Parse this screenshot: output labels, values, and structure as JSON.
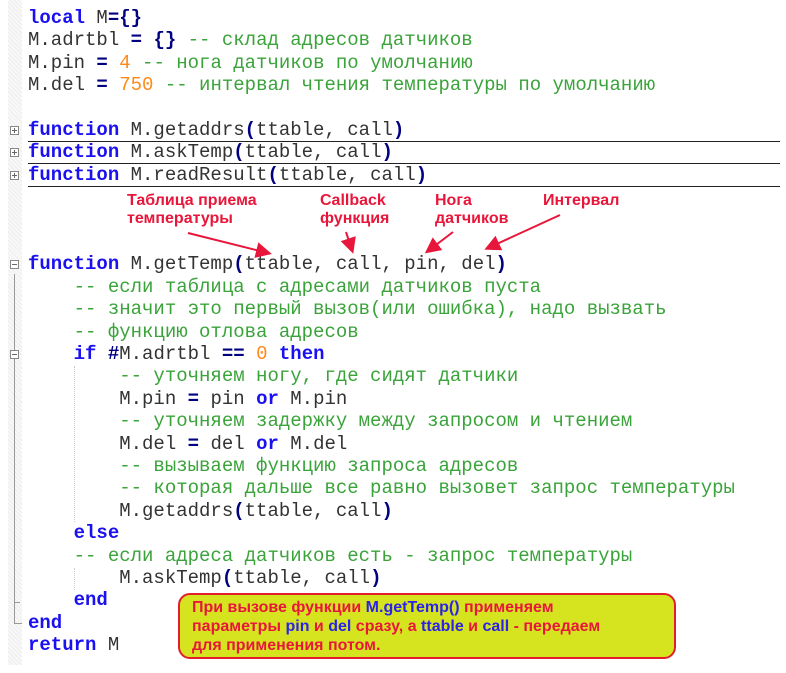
{
  "colors": {
    "keyword": "#1a10f0",
    "operator": "#000080",
    "number": "#ff8a1a",
    "comment": "#3aa33a",
    "annotation": "#e8163a",
    "callout_bg": "#d6e420"
  },
  "code": [
    {
      "row": 0,
      "tokens": [
        [
          "kw",
          "local"
        ],
        [
          "id",
          " M"
        ],
        [
          "op",
          "={}"
        ]
      ]
    },
    {
      "row": 1,
      "tokens": [
        [
          "id",
          "M.adrtbl "
        ],
        [
          "op",
          "="
        ],
        [
          "id",
          " "
        ],
        [
          "op",
          "{}"
        ],
        [
          "cmt",
          " -- склад адресов датчиков"
        ]
      ]
    },
    {
      "row": 2,
      "tokens": [
        [
          "id",
          "M.pin "
        ],
        [
          "op",
          "="
        ],
        [
          "id",
          " "
        ],
        [
          "num",
          "4"
        ],
        [
          "cmt",
          " -- нога датчиков по умолчанию"
        ]
      ]
    },
    {
      "row": 3,
      "tokens": [
        [
          "id",
          "M.del "
        ],
        [
          "op",
          "="
        ],
        [
          "id",
          " "
        ],
        [
          "num",
          "750"
        ],
        [
          "cmt",
          " -- интервал чтения температуры по умолчанию"
        ]
      ]
    },
    {
      "row": 5,
      "fold": "plus",
      "folded": true,
      "tokens": [
        [
          "kw",
          "function"
        ],
        [
          "id",
          " M.getaddrs"
        ],
        [
          "op",
          "("
        ],
        [
          "id",
          "ttable, call"
        ],
        [
          "op",
          ")"
        ]
      ]
    },
    {
      "row": 6,
      "fold": "plus",
      "folded": true,
      "tokens": [
        [
          "kw",
          "function"
        ],
        [
          "id",
          " M.askTemp"
        ],
        [
          "op",
          "("
        ],
        [
          "id",
          "ttable, call"
        ],
        [
          "op",
          ")"
        ]
      ]
    },
    {
      "row": 7,
      "fold": "plus",
      "folded": true,
      "tokens": [
        [
          "kw",
          "function"
        ],
        [
          "id",
          " M.readResult"
        ],
        [
          "op",
          "("
        ],
        [
          "id",
          "ttable, call"
        ],
        [
          "op",
          ")"
        ]
      ]
    },
    {
      "row": 11,
      "fold": "minus",
      "tokens": [
        [
          "kw",
          "function"
        ],
        [
          "id",
          " M.getTemp"
        ],
        [
          "op",
          "("
        ],
        [
          "id",
          "ttable, call, pin, del"
        ],
        [
          "op",
          ")"
        ]
      ]
    },
    {
      "row": 12,
      "tokens": [
        [
          "cmt",
          "    -- если таблица с адресами датчиков пуста"
        ]
      ]
    },
    {
      "row": 13,
      "tokens": [
        [
          "cmt",
          "    -- значит это первый вызов(или ошибка), надо вызвать"
        ]
      ]
    },
    {
      "row": 14,
      "tokens": [
        [
          "cmt",
          "    -- функцию отлова адресов"
        ]
      ]
    },
    {
      "row": 15,
      "fold": "minus",
      "tokens": [
        [
          "id",
          "    "
        ],
        [
          "kw",
          "if"
        ],
        [
          "id",
          " "
        ],
        [
          "op",
          "#"
        ],
        [
          "id",
          "M.adrtbl "
        ],
        [
          "op",
          "=="
        ],
        [
          "id",
          " "
        ],
        [
          "num",
          "0"
        ],
        [
          "id",
          " "
        ],
        [
          "kw",
          "then"
        ]
      ]
    },
    {
      "row": 16,
      "tokens": [
        [
          "cmt",
          "        -- уточняем ногу, где сидят датчики"
        ]
      ]
    },
    {
      "row": 17,
      "tokens": [
        [
          "id",
          "        M.pin "
        ],
        [
          "op",
          "="
        ],
        [
          "id",
          " pin "
        ],
        [
          "kw",
          "or"
        ],
        [
          "id",
          " M.pin"
        ]
      ]
    },
    {
      "row": 18,
      "tokens": [
        [
          "cmt",
          "        -- уточняем задержку между запросом и чтением"
        ]
      ]
    },
    {
      "row": 19,
      "tokens": [
        [
          "id",
          "        M.del "
        ],
        [
          "op",
          "="
        ],
        [
          "id",
          " del "
        ],
        [
          "kw",
          "or"
        ],
        [
          "id",
          " M.del"
        ]
      ]
    },
    {
      "row": 20,
      "tokens": [
        [
          "cmt",
          "        -- вызываем функцию запроса адресов"
        ]
      ]
    },
    {
      "row": 21,
      "tokens": [
        [
          "cmt",
          "        -- которая дальше все равно вызовет запрос температуры"
        ]
      ]
    },
    {
      "row": 22,
      "tokens": [
        [
          "id",
          "        M.getaddrs"
        ],
        [
          "op",
          "("
        ],
        [
          "id",
          "ttable, call"
        ],
        [
          "op",
          ")"
        ]
      ]
    },
    {
      "row": 23,
      "tokens": [
        [
          "id",
          "    "
        ],
        [
          "kw",
          "else"
        ]
      ]
    },
    {
      "row": 24,
      "tokens": [
        [
          "cmt",
          "    -- если адреса датчиков есть - запрос температуры"
        ]
      ]
    },
    {
      "row": 25,
      "tokens": [
        [
          "id",
          "        M.askTemp"
        ],
        [
          "op",
          "("
        ],
        [
          "id",
          "ttable, call"
        ],
        [
          "op",
          ")"
        ]
      ]
    },
    {
      "row": 26,
      "tokens": [
        [
          "id",
          "    "
        ],
        [
          "kw",
          "end"
        ]
      ]
    },
    {
      "row": 27,
      "tokens": [
        [
          "kw",
          "end"
        ]
      ]
    },
    {
      "row": 28,
      "tokens": [
        [
          "kw",
          "return"
        ],
        [
          "id",
          " M"
        ]
      ]
    }
  ],
  "annotations": {
    "table": {
      "line1": "Таблица приема",
      "line2": "температуры"
    },
    "callback": {
      "line1": "Callback",
      "line2": "функция"
    },
    "pin": {
      "line1": "Нога",
      "line2": "датчиков"
    },
    "interval": {
      "line1": "Интервал"
    }
  },
  "callout": {
    "p1": "При  вызове функции ",
    "p2": "M.getTemp()",
    "p3": " применяем",
    "p4": "параметры ",
    "p5": "pin",
    "p6": " и ",
    "p7": "del",
    "p8": " сразу, а ",
    "p9": "ttable",
    "p10": " и ",
    "p11": "call",
    "p12": " - передаем",
    "p13": "для применения потом."
  }
}
